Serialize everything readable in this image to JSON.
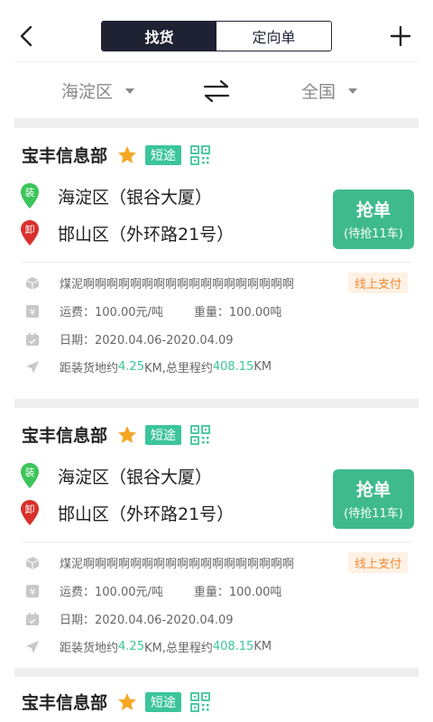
{
  "header": {
    "tabs": [
      {
        "label": "找货",
        "active": true
      },
      {
        "label": "定向单",
        "active": false
      }
    ]
  },
  "filter": {
    "from": "海淀区",
    "to": "全国"
  },
  "cards": [
    {
      "company": "宝丰信息部",
      "tag": "短途",
      "load_badge": "装",
      "load_location": "海淀区（银谷大厦）",
      "unload_badge": "卸",
      "unload_location": "邯山区（外环路21号）",
      "grab_label": "抢单",
      "grab_sub": "(待抢11车)",
      "cargo": "煤泥啊啊啊啊啊啊啊啊啊啊啊啊啊啊啊啊啊啊",
      "payment": "线上支付",
      "freight": "运费：100.00元/吨",
      "weight": "重量：100.00吨",
      "date": "日期：2020.04.06-2020.04.09",
      "distance_prefix": "距装货地约",
      "distance_load": "4.25",
      "distance_mid": "KM,总里程约",
      "distance_total": "408.15",
      "distance_suffix": "KM"
    },
    {
      "company": "宝丰信息部",
      "tag": "短途",
      "load_badge": "装",
      "load_location": "海淀区（银谷大厦）",
      "unload_badge": "卸",
      "unload_location": "邯山区（外环路21号）",
      "grab_label": "抢单",
      "grab_sub": "(待抢11车)",
      "cargo": "煤泥啊啊啊啊啊啊啊啊啊啊啊啊啊啊啊啊啊啊",
      "payment": "线上支付",
      "freight": "运费：100.00元/吨",
      "weight": "重量：100.00吨",
      "date": "日期：2020.04.06-2020.04.09",
      "distance_prefix": "距装货地约",
      "distance_load": "4.25",
      "distance_mid": "KM,总里程约",
      "distance_total": "408.15",
      "distance_suffix": "KM"
    },
    {
      "company": "宝丰信息部",
      "tag": "短途"
    }
  ],
  "colors": {
    "accent": "#3fba8c",
    "dark": "#1f2233",
    "load_pin": "#3cc55a",
    "unload_pin": "#d9302a",
    "star": "#f5a623",
    "pay_tag": "#f08a30"
  }
}
